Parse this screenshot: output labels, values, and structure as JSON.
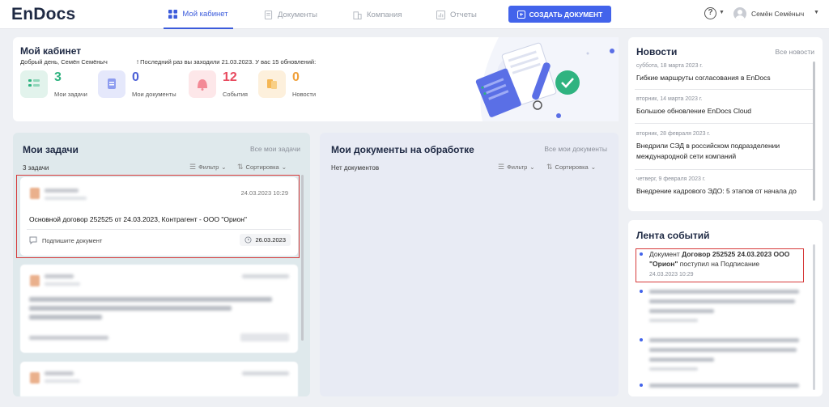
{
  "header": {
    "logo": "EnDocs",
    "nav": [
      {
        "label": "Мой кабинет"
      },
      {
        "label": "Документы"
      },
      {
        "label": "Компания"
      },
      {
        "label": "Отчеты"
      }
    ],
    "create_button": "СОЗДАТЬ ДОКУМЕНТ",
    "help": "?",
    "user_name": "Семён Семёныч"
  },
  "cabinet": {
    "title": "Мой кабинет",
    "greeting": "Добрый день, Семён Семёныч",
    "last_visit": "! Последний раз вы заходили 21.03.2023.  У вас 15 обновлений:",
    "stats": [
      {
        "value": "3",
        "label": "Мои задачи",
        "color": "#2fb380"
      },
      {
        "value": "0",
        "label": "Мои документы",
        "color": "#4b5fd6"
      },
      {
        "value": "12",
        "label": "События",
        "color": "#e84a5f"
      },
      {
        "value": "0",
        "label": "Новости",
        "color": "#f0a03a"
      }
    ]
  },
  "tasks": {
    "title": "Мои задачи",
    "all_link": "Все мои задачи",
    "count": "3 задачи",
    "filter": "Фильтр",
    "sort": "Сортировка",
    "items": [
      {
        "date": "24.03.2023 10:29",
        "doc_title": "Основной договор 252525 от 24.03.2023, Контрагент - ООО \"Орион\"",
        "action": "Подпишите документ",
        "due": "26.03.2023"
      }
    ]
  },
  "docs": {
    "title": "Мои документы на обработке",
    "all_link": "Все мои документы",
    "empty": "Нет документов",
    "filter": "Фильтр",
    "sort": "Сортировка"
  },
  "news": {
    "title": "Новости",
    "all_link": "Все новости",
    "items": [
      {
        "date": "суббота, 18 марта 2023 г.",
        "text": "Гибкие маршруты согласования в EnDocs"
      },
      {
        "date": "вторник, 14 марта 2023 г.",
        "text": "Большое обновление EnDocs Cloud"
      },
      {
        "date": "вторник, 28 февраля 2023 г.",
        "text": "Внедрили СЭД в российском подразделении международной сети компаний"
      },
      {
        "date": "четверг, 9 февраля 2023 г.",
        "text": "Внедрение кадрового ЭДО: 5 этапов от начала до"
      }
    ]
  },
  "feed": {
    "title": "Лента событий",
    "first": {
      "prefix": "Документ ",
      "doc": "Договор 252525 24.03.2023 ООО \"Орион\"",
      "suffix": " поступил на Подписание",
      "time": "24.03.2023 10:29"
    }
  }
}
